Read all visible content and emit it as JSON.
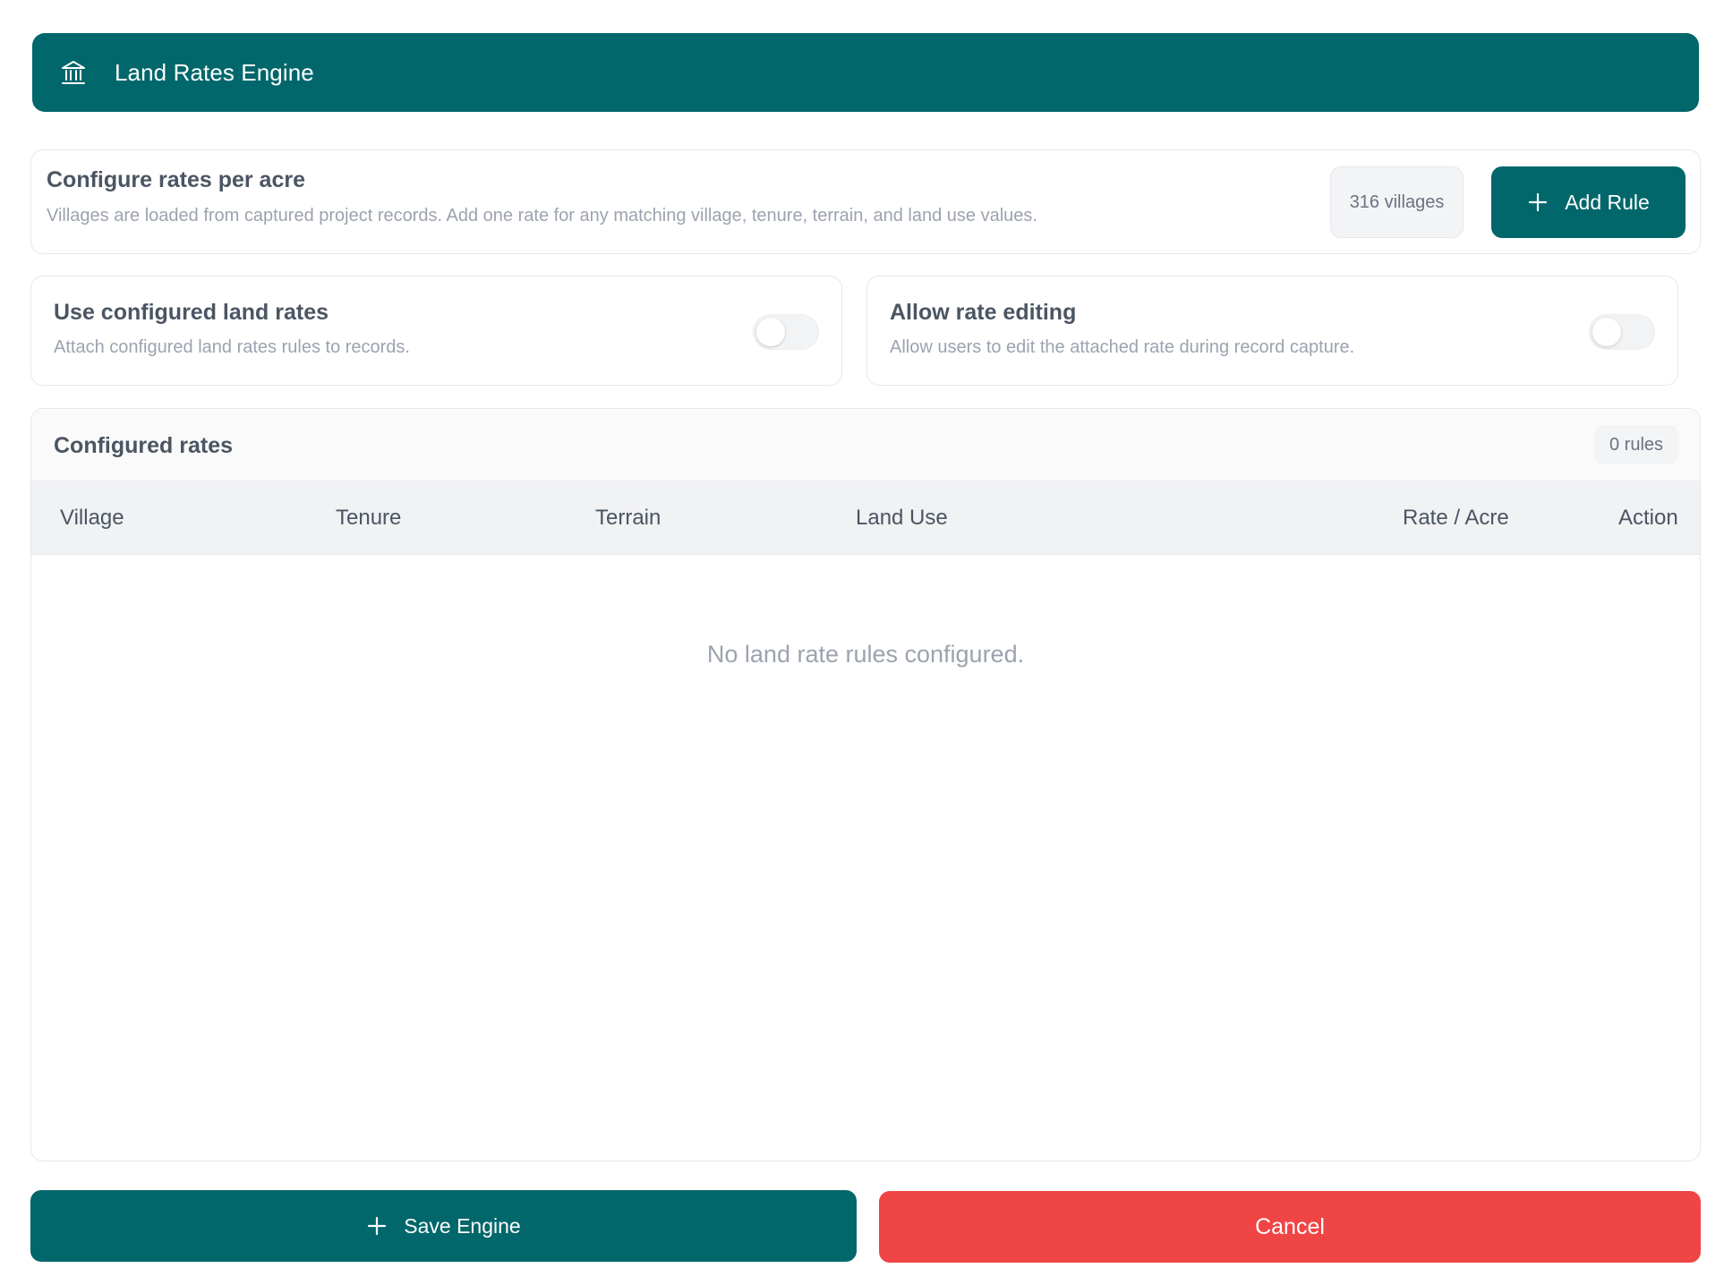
{
  "header": {
    "title": "Land Rates Engine",
    "icon": "bank-icon"
  },
  "config": {
    "heading": "Configure rates per acre",
    "description": "Villages are loaded from captured project records. Add one rate for any matching village, tenure, terrain, and land use values.",
    "villages_badge": "316 villages",
    "add_rule_label": "Add Rule"
  },
  "toggles": [
    {
      "heading": "Use configured land rates",
      "description": "Attach configured land rates rules to records.",
      "enabled": false
    },
    {
      "heading": "Allow rate editing",
      "description": "Allow users to edit the attached rate during record capture.",
      "enabled": false
    }
  ],
  "rates": {
    "title": "Configured rates",
    "rules_badge": "0 rules",
    "columns": [
      "Village",
      "Tenure",
      "Terrain",
      "Land Use",
      "Rate / Acre",
      "Action"
    ],
    "empty_message": "No land rate rules configured."
  },
  "actions": {
    "save_label": "Save Engine",
    "cancel_label": "Cancel"
  },
  "colors": {
    "primary": "#01676b",
    "danger": "#f04545"
  }
}
